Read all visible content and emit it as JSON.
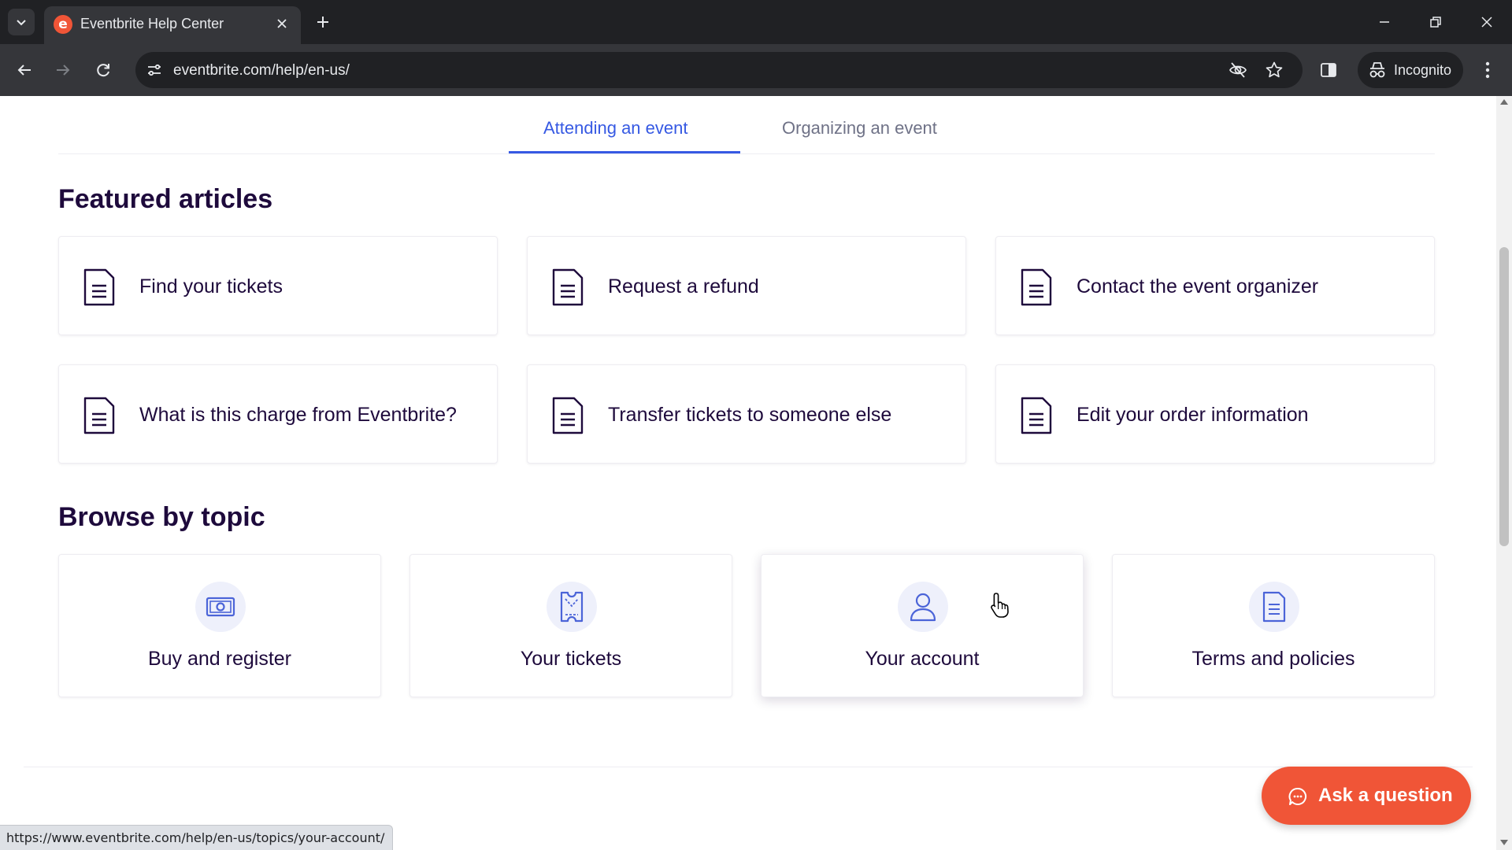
{
  "browser": {
    "tab_title": "Eventbrite Help Center",
    "favicon_letter": "e",
    "url": "eventbrite.com/help/en-us/",
    "incognito_label": "Incognito",
    "status_url": "https://www.eventbrite.com/help/en-us/topics/your-account/"
  },
  "page": {
    "tabs": [
      {
        "label": "Attending an event",
        "active": true
      },
      {
        "label": "Organizing an event",
        "active": false
      }
    ],
    "featured_title": "Featured articles",
    "featured_articles": [
      {
        "label": "Find your tickets",
        "icon": "document-icon"
      },
      {
        "label": "Request a refund",
        "icon": "document-icon"
      },
      {
        "label": "Contact the event organizer",
        "icon": "document-icon"
      },
      {
        "label": "What is this charge from Eventbrite?",
        "icon": "document-icon"
      },
      {
        "label": "Transfer tickets to someone else",
        "icon": "document-icon"
      },
      {
        "label": "Edit your order information",
        "icon": "document-icon"
      }
    ],
    "browse_title": "Browse by topic",
    "topics": [
      {
        "label": "Buy and register",
        "icon": "cash-icon"
      },
      {
        "label": "Your tickets",
        "icon": "ticket-icon"
      },
      {
        "label": "Your account",
        "icon": "user-icon"
      },
      {
        "label": "Terms and policies",
        "icon": "policy-document-icon"
      }
    ],
    "ask_button": "Ask a question"
  },
  "colors": {
    "brand_orange": "#f05537",
    "tab_active_blue": "#3659e3",
    "heading_text": "#1e0a3c",
    "icon_blue": "#4b64d8"
  }
}
